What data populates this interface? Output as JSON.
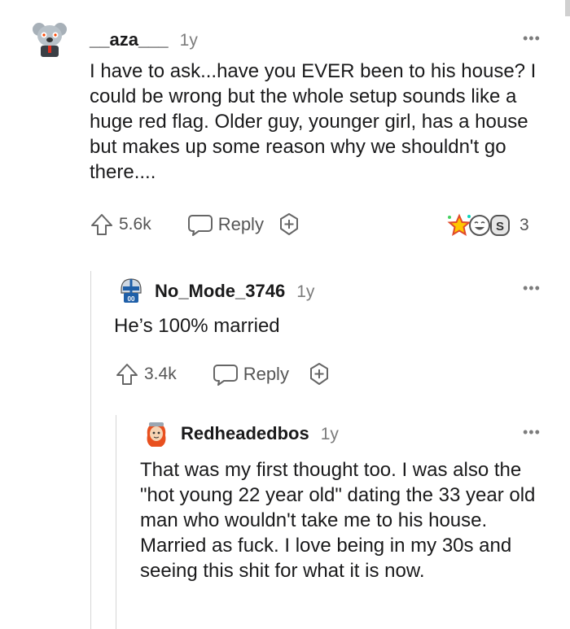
{
  "comments": [
    {
      "username": "__aza___",
      "age": "1y",
      "text": "I have to ask...have you EVER been to his house? I could be wrong but the whole setup sounds like a huge red flag. Older guy, younger girl, has a house but makes up some reason why we shouldn't go there....",
      "votes": "5.6k",
      "reply_label": "Reply",
      "award_count": "3",
      "avatar_icon": "koala-avatar-icon"
    },
    {
      "username": "No_Mode_3746",
      "age": "1y",
      "text": "He’s 100% married",
      "votes": "3.4k",
      "reply_label": "Reply",
      "avatar_icon": "football-helmet-avatar-icon"
    },
    {
      "username": "Redheadedbos",
      "age": "1y",
      "text": "That was my first thought too. I was also the \"hot young 22 year old\" dating the 33 year old man who wouldn't take me to his house. Married as fuck. I love being in my 30s and seeing this shit for what it is now.",
      "avatar_icon": "redhead-avatar-icon"
    }
  ],
  "more_options_label": "•••",
  "colors": {
    "text": "#1a1a1b",
    "meta": "#7c7c7c",
    "action": "#555555",
    "thread_line": "#d6d6d6"
  }
}
